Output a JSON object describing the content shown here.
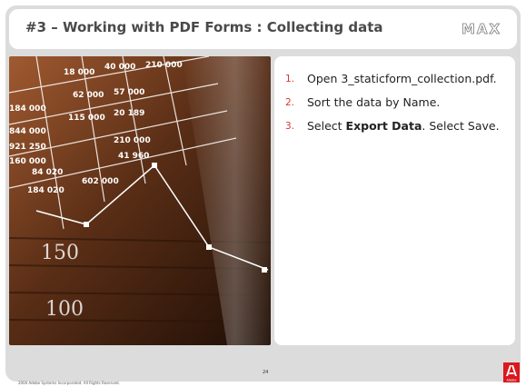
{
  "slide": {
    "title": "#3 – Working with PDF Forms : Collecting data",
    "logo_text": "MAX",
    "steps": [
      {
        "num": "1.",
        "parts": [
          "Open 3_staticform_collection.pdf."
        ]
      },
      {
        "num": "2.",
        "parts": [
          "Sort the data by Name."
        ]
      },
      {
        "num": "3.",
        "before": "Select ",
        "bold": "Export Data",
        "after": ". Select Save."
      }
    ],
    "footer": {
      "copyright": "2004 Adobe Systems Incorporated. All Rights Reserved.",
      "page_number": "24",
      "brand": "Adobe"
    }
  },
  "colors": {
    "accent": "#d8382d",
    "frame": "#dcdcdc",
    "title_text": "#4a4a4a",
    "adobe_red": "#d8191e"
  },
  "photo": {
    "icon": "financial-data-image",
    "axis_labels": [
      "150",
      "100"
    ],
    "figures": [
      "18 000",
      "40 000",
      "210 000",
      "62 000",
      "57 000",
      "184 000",
      "115 000",
      "20 189",
      "844 000",
      "921 250",
      "210 000",
      "41 960",
      "84 020",
      "160 000",
      "184 020",
      "602 000"
    ]
  }
}
